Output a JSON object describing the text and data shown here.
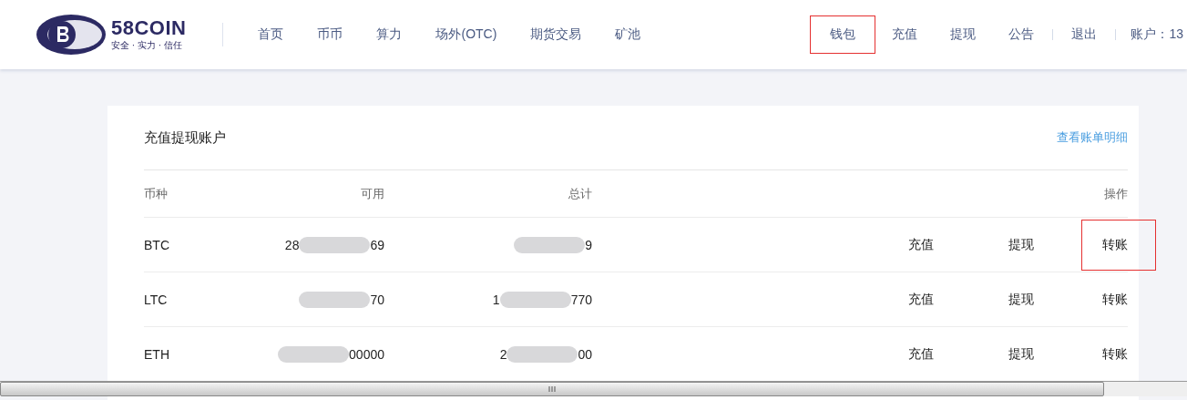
{
  "header": {
    "logo": {
      "name": "58COIN",
      "slogan": "安全 · 实力 · 信任"
    },
    "nav": [
      {
        "label": "首页"
      },
      {
        "label": "币币"
      },
      {
        "label": "算力"
      },
      {
        "label": "场外(OTC)"
      },
      {
        "label": "期货交易"
      },
      {
        "label": "矿池"
      }
    ],
    "right_nav": [
      {
        "label": "钱包",
        "highlighted": true
      },
      {
        "label": "充值",
        "highlighted": false
      },
      {
        "label": "提现",
        "highlighted": false
      },
      {
        "label": "公告",
        "highlighted": false
      }
    ],
    "logout": "退出",
    "account": "账户：13"
  },
  "panel": {
    "title": "充值提现账户",
    "link": "查看账单明细",
    "columns": [
      "币种",
      "可用",
      "总计",
      "操作"
    ],
    "rows": [
      {
        "coin": "BTC",
        "available": {
          "start": "28",
          "end": "69"
        },
        "total": {
          "end": "9"
        },
        "actions": [
          {
            "label": "充值",
            "highlighted": false
          },
          {
            "label": "提现",
            "highlighted": false
          },
          {
            "label": "转账",
            "highlighted": true
          }
        ]
      },
      {
        "coin": "LTC",
        "available": {
          "end": "70"
        },
        "total": {
          "start": "1",
          "end": "770"
        },
        "actions": [
          {
            "label": "充值",
            "highlighted": false
          },
          {
            "label": "提现",
            "highlighted": false
          },
          {
            "label": "转账",
            "highlighted": false
          }
        ]
      },
      {
        "coin": "ETH",
        "available": {
          "end": "00000"
        },
        "total": {
          "start": "2",
          "end": "00"
        },
        "actions": [
          {
            "label": "充值",
            "highlighted": false
          },
          {
            "label": "提现",
            "highlighted": false
          },
          {
            "label": "转账",
            "highlighted": false
          }
        ]
      }
    ]
  }
}
